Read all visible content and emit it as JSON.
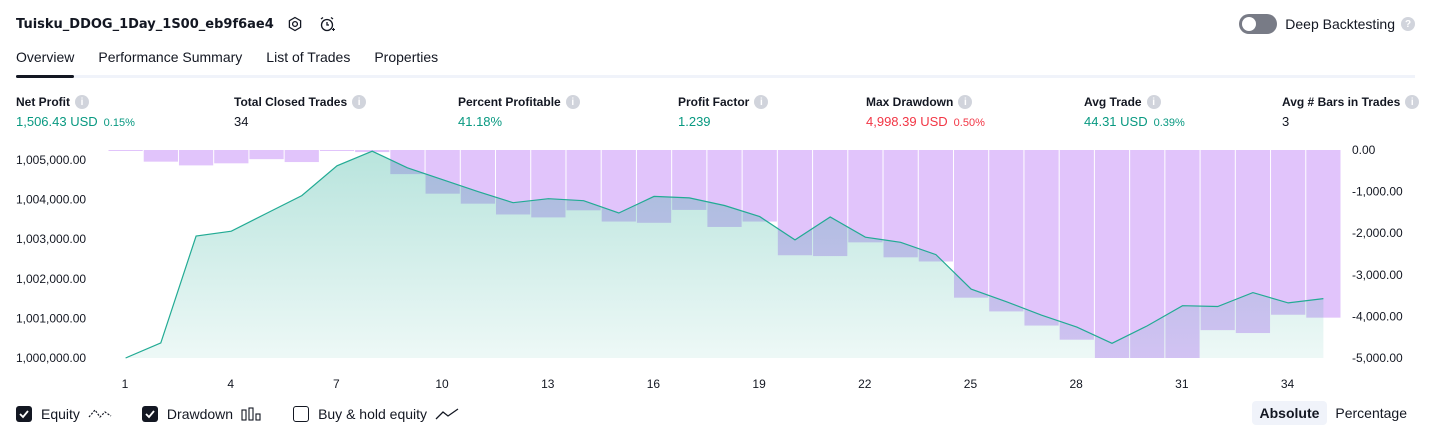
{
  "header": {
    "strategy_name": "Tuisku_DDOG_1Day_1S00_eb9f6ae4",
    "deep_backtesting_label": "Deep Backtesting"
  },
  "tabs": [
    {
      "label": "Overview"
    },
    {
      "label": "Performance Summary"
    },
    {
      "label": "List of Trades"
    },
    {
      "label": "Properties"
    }
  ],
  "metrics": {
    "net_profit": {
      "label": "Net Profit",
      "value": "1,506.43 USD",
      "pct": "0.15%"
    },
    "total_closed_trades": {
      "label": "Total Closed Trades",
      "value": "34"
    },
    "percent_profitable": {
      "label": "Percent Profitable",
      "value": "41.18%"
    },
    "profit_factor": {
      "label": "Profit Factor",
      "value": "1.239"
    },
    "max_drawdown": {
      "label": "Max Drawdown",
      "value": "4,998.39 USD",
      "pct": "0.50%"
    },
    "avg_trade": {
      "label": "Avg Trade",
      "value": "44.31 USD",
      "pct": "0.39%"
    },
    "avg_bars": {
      "label": "Avg # Bars in Trades",
      "value": "3"
    }
  },
  "legend": {
    "equity": "Equity",
    "drawdown": "Drawdown",
    "buy_hold": "Buy & hold equity"
  },
  "modes": {
    "absolute": "Absolute",
    "percentage": "Percentage"
  },
  "colors": {
    "equity_line": "#22ab94",
    "drawdown_fill": "#e1c4fb",
    "positive": "#089981",
    "negative": "#f23645"
  },
  "chart_data": {
    "type": "area",
    "x_ticks": [
      "1",
      "4",
      "7",
      "10",
      "13",
      "16",
      "19",
      "22",
      "25",
      "28",
      "31",
      "34"
    ],
    "x_range": [
      1,
      35
    ],
    "left_axis": {
      "ticks": [
        "1,005,000.00",
        "1,004,000.00",
        "1,003,000.00",
        "1,002,000.00",
        "1,001,000.00",
        "1,000,000.00"
      ],
      "range": [
        1000000,
        1005250
      ]
    },
    "right_axis": {
      "ticks": [
        "0.00",
        "-1,000.00",
        "-2,000.00",
        "-3,000.00",
        "-4,000.00",
        "-5,000.00"
      ],
      "range": [
        -5000,
        0
      ]
    },
    "series": [
      {
        "name": "Equity",
        "x": [
          1,
          2,
          3,
          4,
          5,
          6,
          7,
          8,
          9,
          10,
          11,
          12,
          13,
          14,
          15,
          16,
          17,
          18,
          19,
          20,
          21,
          22,
          23,
          24,
          25,
          26,
          27,
          28,
          29,
          30,
          31,
          32,
          33,
          34,
          35
        ],
        "values": [
          1000000,
          1000380,
          1003080,
          1003200,
          1003650,
          1004100,
          1004850,
          1005220,
          1004800,
          1004500,
          1004200,
          1003920,
          1004020,
          1003970,
          1003660,
          1004080,
          1004040,
          1003850,
          1003570,
          1002980,
          1003560,
          1003050,
          1002920,
          1002610,
          1001740,
          1001420,
          1001080,
          1000780,
          1000370,
          1000810,
          1001320,
          1001300,
          1001650,
          1001390,
          1001500
        ]
      },
      {
        "name": "Drawdown",
        "x": [
          1,
          2,
          3,
          4,
          5,
          6,
          7,
          8,
          9,
          10,
          11,
          12,
          13,
          14,
          15,
          16,
          17,
          18,
          19,
          20,
          21,
          22,
          23,
          24,
          25,
          26,
          27,
          28,
          29,
          30,
          31,
          32,
          33,
          34,
          35
        ],
        "values": [
          -10,
          -280,
          -370,
          -320,
          -220,
          -290,
          -20,
          -50,
          -580,
          -1050,
          -1290,
          -1550,
          -1620,
          -1450,
          -1720,
          -1750,
          -1440,
          -1850,
          -1720,
          -2530,
          -2550,
          -2220,
          -2580,
          -2680,
          -3550,
          -3880,
          -4220,
          -4560,
          -5000,
          -5000,
          -5000,
          -4330,
          -4400,
          -3960,
          -4030
        ]
      }
    ]
  }
}
